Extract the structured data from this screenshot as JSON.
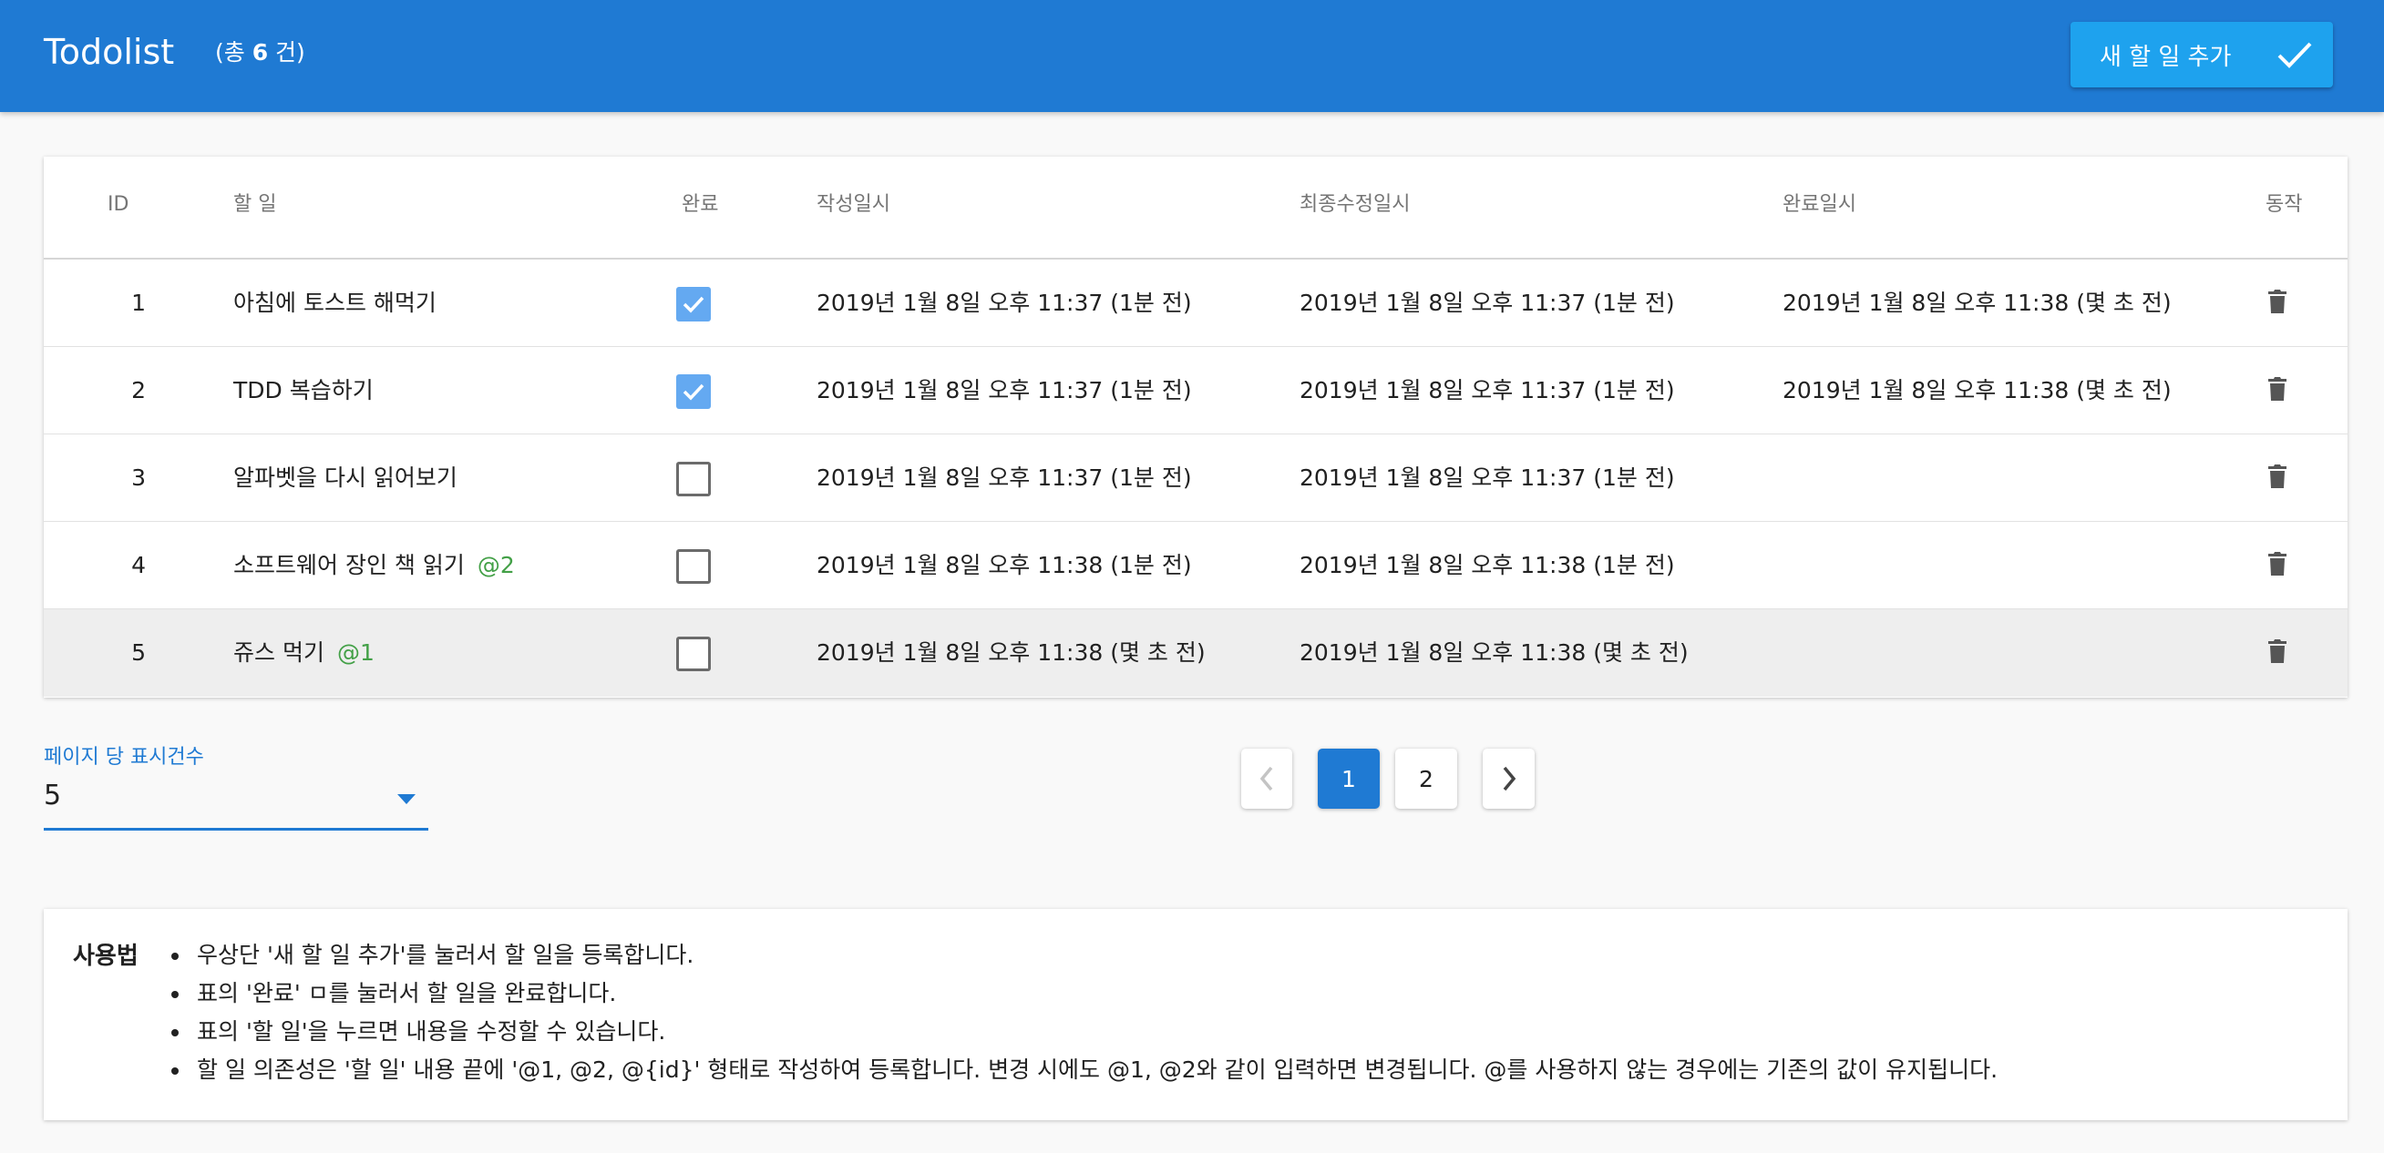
{
  "app": {
    "title": "Todolist",
    "count_prefix": "(총 ",
    "count_value": "6",
    "count_suffix": " 건)",
    "add_button_label": "새 할 일 추가",
    "primary_color": "#1f7ad3",
    "accent_color": "#1ea2ee"
  },
  "table": {
    "headers": {
      "id": "ID",
      "task": "할 일",
      "done": "완료",
      "created": "작성일시",
      "modified": "최종수정일시",
      "completed": "완료일시",
      "action": "동작"
    },
    "rows": [
      {
        "id": "1",
        "task": "아침에 토스트 해먹기",
        "dep": "",
        "checked": true,
        "created": "2019년 1월 8일 오후 11:37 (1분 전)",
        "modified": "2019년 1월 8일 오후 11:37 (1분 전)",
        "completed": "2019년 1월 8일 오후 11:38 (몇 초 전)"
      },
      {
        "id": "2",
        "task": "TDD 복습하기",
        "dep": "",
        "checked": true,
        "created": "2019년 1월 8일 오후 11:37 (1분 전)",
        "modified": "2019년 1월 8일 오후 11:37 (1분 전)",
        "completed": "2019년 1월 8일 오후 11:38 (몇 초 전)"
      },
      {
        "id": "3",
        "task": "알파벳을 다시 읽어보기",
        "dep": "",
        "checked": false,
        "created": "2019년 1월 8일 오후 11:37 (1분 전)",
        "modified": "2019년 1월 8일 오후 11:37 (1분 전)",
        "completed": ""
      },
      {
        "id": "4",
        "task": "소프트웨어 장인 책 읽기",
        "dep": "@2",
        "checked": false,
        "created": "2019년 1월 8일 오후 11:38 (1분 전)",
        "modified": "2019년 1월 8일 오후 11:38 (1분 전)",
        "completed": ""
      },
      {
        "id": "5",
        "task": "쥬스 먹기",
        "dep": "@1",
        "checked": false,
        "created": "2019년 1월 8일 오후 11:38 (몇 초 전)",
        "modified": "2019년 1월 8일 오후 11:38 (몇 초 전)",
        "completed": ""
      }
    ]
  },
  "per_page": {
    "label": "페이지 당 표시건수",
    "value": "5"
  },
  "pagination": {
    "pages": [
      "1",
      "2"
    ],
    "current": "1"
  },
  "help": {
    "title": "사용법",
    "items": [
      "우상단 '새 할 일 추가'를 눌러서 할 일을 등록합니다.",
      "표의 '완료' ㅁ를 눌러서 할 일을 완료합니다.",
      "표의 '할 일'을 누르면 내용을 수정할 수 있습니다.",
      "할 일 의존성은 '할 일' 내용 끝에 '@1, @2, @{id}' 형태로 작성하여 등록합니다. 변경 시에도 @1, @2와 같이 입력하면 변경됩니다. @를 사용하지 않는 경우에는 기존의 값이 유지됩니다."
    ]
  }
}
